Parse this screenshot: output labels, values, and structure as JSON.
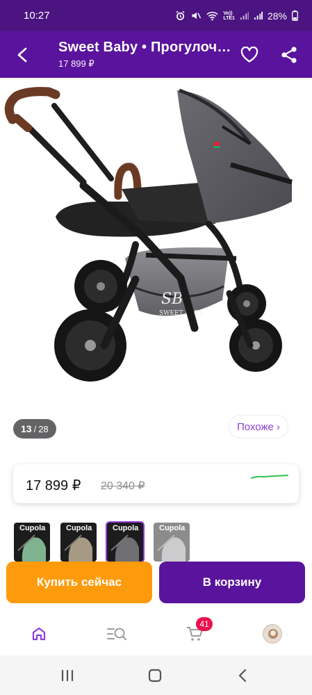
{
  "status_bar": {
    "time": "10:27",
    "lte_label_top": "Vo))",
    "lte_label_bottom": "LTE1",
    "battery": "28%"
  },
  "header": {
    "title": "Sweet Baby • Прогулочная коляска Cupola Grey",
    "price_subtitle": "17 899 ₽"
  },
  "gallery": {
    "brand_mark": "SB",
    "brand_name": "SWEET BABY",
    "counter_current": "13",
    "counter_separator": "/",
    "counter_total": "28",
    "similar_label": "Похоже ›"
  },
  "price": {
    "current": "17 899 ₽",
    "old": "20 340 ₽",
    "accent_color": "#2fbf4f"
  },
  "thumbnails": [
    {
      "label": "Cupola",
      "tint": "#7fb28f",
      "state": "default"
    },
    {
      "label": "Cupola",
      "tint": "#a69a84",
      "state": "default"
    },
    {
      "label": "Cupola",
      "tint": "#6e6e73",
      "state": "active"
    },
    {
      "label": "Cupola",
      "tint": "#9a9a9e",
      "state": "faded"
    }
  ],
  "actions": {
    "buy_now": "Купить сейчас",
    "add_to_cart": "В корзину"
  },
  "bottom_nav": {
    "cart_badge": "41"
  },
  "colors": {
    "brand_purple": "#5a139c",
    "status_purple": "#4b1480",
    "buy_orange": "#fd9b0d",
    "badge_red": "#e8124e"
  }
}
